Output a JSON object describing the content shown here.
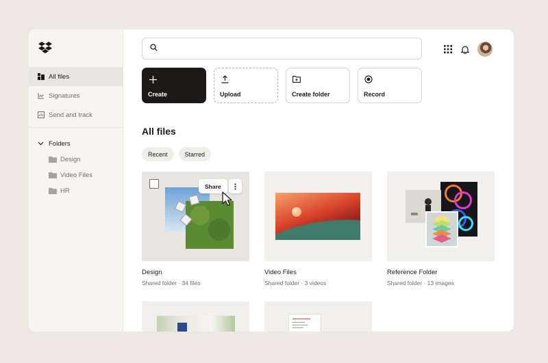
{
  "sidebar": {
    "items": [
      {
        "label": "All files",
        "icon": "all-files-icon",
        "active": true
      },
      {
        "label": "Signatures",
        "icon": "signature-icon",
        "active": false
      },
      {
        "label": "Send and track",
        "icon": "send-track-icon",
        "active": false
      }
    ],
    "folders_label": "Folders",
    "folders": [
      {
        "label": "Design"
      },
      {
        "label": "Video Files"
      },
      {
        "label": "HR"
      }
    ]
  },
  "search": {
    "placeholder": "",
    "value": ""
  },
  "actions": [
    {
      "label": "Create",
      "icon": "plus-icon"
    },
    {
      "label": "Upload",
      "icon": "upload-icon"
    },
    {
      "label": "Create folder",
      "icon": "create-folder-icon"
    },
    {
      "label": "Record",
      "icon": "record-icon"
    }
  ],
  "section_title": "All files",
  "filters": [
    {
      "label": "Recent"
    },
    {
      "label": "Starred"
    }
  ],
  "cards": [
    {
      "title": "Design",
      "subtitle": "Shared folder · 34 files",
      "share_label": "Share"
    },
    {
      "title": "Video Files",
      "subtitle": "Shared folder · 3 videos"
    },
    {
      "title": "Reference Folder",
      "subtitle": "Shared folder · 13 images"
    }
  ],
  "colors": {
    "primary_button": "#1e1919",
    "sidebar_bg": "#f7f5f2",
    "page_bg": "#ede8e2",
    "text_secondary": "#736c64"
  }
}
